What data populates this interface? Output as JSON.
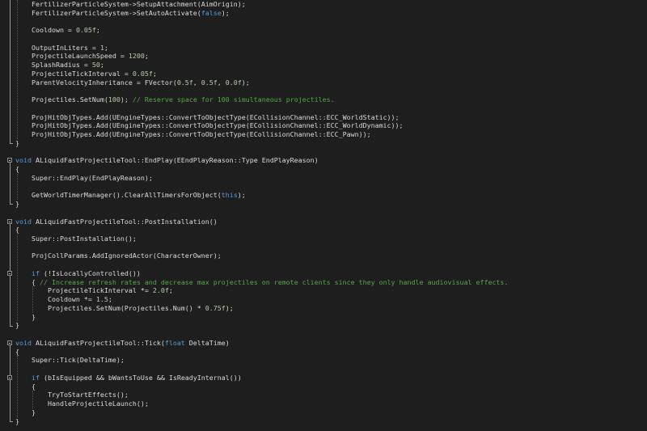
{
  "editor": {
    "colors": {
      "background": "#1e1e1e",
      "text": "#dcdcdc",
      "keyword": "#569cd6",
      "number": "#b5cea8",
      "comment": "#57a64a"
    },
    "lines": [
      {
        "text": "    FertilizerParticleSystem->SetupAttachment(AimOrigin);"
      },
      {
        "text": "    FertilizerParticleSystem->SetAutoActivate(false);"
      },
      {
        "text": ""
      },
      {
        "text": "    Cooldown = 0.05f;"
      },
      {
        "text": ""
      },
      {
        "text": "    OutputInLiters = 1;"
      },
      {
        "text": "    ProjectileLaunchSpeed = 1200;"
      },
      {
        "text": "    SplashRadius = 50;"
      },
      {
        "text": "    ProjectileTickInterval = 0.05f;"
      },
      {
        "text": "    ParentVelocityInheritance = FVector(0.5f, 0.5f, 0.0f);"
      },
      {
        "text": ""
      },
      {
        "text": "    Projectiles.SetNum(100); // Reserve space for 100 simultaneous projectiles."
      },
      {
        "text": ""
      },
      {
        "text": "    ProjHitObjTypes.Add(UEngineTypes::ConvertToObjectType(ECollisionChannel::ECC_WorldStatic));"
      },
      {
        "text": "    ProjHitObjTypes.Add(UEngineTypes::ConvertToObjectType(ECollisionChannel::ECC_WorldDynamic));"
      },
      {
        "text": "    ProjHitObjTypes.Add(UEngineTypes::ConvertToObjectType(ECollisionChannel::ECC_Pawn));"
      },
      {
        "text": "}"
      },
      {
        "text": ""
      },
      {
        "text": "void ALiquidFastProjectileTool::EndPlay(EEndPlayReason::Type EndPlayReason)"
      },
      {
        "text": "{"
      },
      {
        "text": "    Super::EndPlay(EndPlayReason);"
      },
      {
        "text": ""
      },
      {
        "text": "    GetWorldTimerManager().ClearAllTimersForObject(this);"
      },
      {
        "text": "}"
      },
      {
        "text": ""
      },
      {
        "text": "void ALiquidFastProjectileTool::PostInstallation()"
      },
      {
        "text": "{"
      },
      {
        "text": "    Super::PostInstallation();"
      },
      {
        "text": ""
      },
      {
        "text": "    ProjCollParams.AddIgnoredActor(CharacterOwner);"
      },
      {
        "text": ""
      },
      {
        "text": "    if (!IsLocallyControlled())"
      },
      {
        "text": "    { // Increase refresh rates and decrease max projectiles on remote clients since they only handle audiovisual effects."
      },
      {
        "text": "        ProjectileTickInterval *= 2.0f;"
      },
      {
        "text": "        Cooldown *= 1.5;"
      },
      {
        "text": "        Projectiles.SetNum(Projectiles.Num() * 0.75f);"
      },
      {
        "text": "    }"
      },
      {
        "text": "}"
      },
      {
        "text": ""
      },
      {
        "text": "void ALiquidFastProjectileTool::Tick(float DeltaTime)"
      },
      {
        "text": "{"
      },
      {
        "text": "    Super::Tick(DeltaTime);"
      },
      {
        "text": ""
      },
      {
        "text": "    if (bIsEquipped && bWantsToUse && IsReadyInternal())"
      },
      {
        "text": "    {"
      },
      {
        "text": "        TryToStartEffects();"
      },
      {
        "text": "        HandleProjectileLaunch();"
      },
      {
        "text": "    }"
      },
      {
        "text": "}"
      }
    ]
  }
}
